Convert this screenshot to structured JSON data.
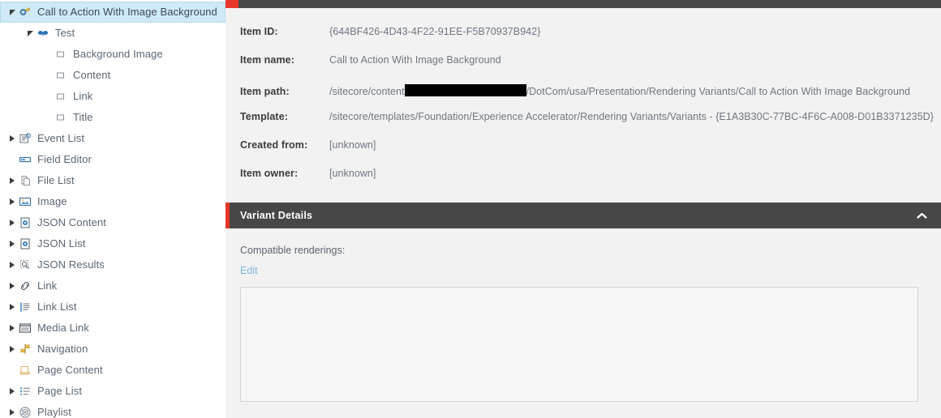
{
  "sidebar": {
    "items": [
      {
        "label": "Call to Action With Image Background",
        "icon": "variant-icon",
        "depth": 0,
        "twisty": "expanded",
        "selected": true
      },
      {
        "label": "Test",
        "icon": "mask-icon",
        "depth": 1,
        "twisty": "expanded",
        "selected": false
      },
      {
        "label": "Background Image",
        "icon": "field-square-icon",
        "depth": 2,
        "twisty": "none",
        "selected": false
      },
      {
        "label": "Content",
        "icon": "field-square-icon",
        "depth": 2,
        "twisty": "none",
        "selected": false
      },
      {
        "label": "Link",
        "icon": "field-square-icon",
        "depth": 2,
        "twisty": "none",
        "selected": false
      },
      {
        "label": "Title",
        "icon": "field-square-icon",
        "depth": 2,
        "twisty": "none",
        "selected": false
      },
      {
        "label": "Event List",
        "icon": "event-list-icon",
        "depth": 0,
        "twisty": "collapsed",
        "selected": false
      },
      {
        "label": "Field Editor",
        "icon": "field-editor-icon",
        "depth": 0,
        "twisty": "none",
        "selected": false
      },
      {
        "label": "File List",
        "icon": "file-list-icon",
        "depth": 0,
        "twisty": "collapsed",
        "selected": false
      },
      {
        "label": "Image",
        "icon": "image-icon",
        "depth": 0,
        "twisty": "collapsed",
        "selected": false
      },
      {
        "label": "JSON Content",
        "icon": "json-content-icon",
        "depth": 0,
        "twisty": "collapsed",
        "selected": false
      },
      {
        "label": "JSON List",
        "icon": "json-list-icon",
        "depth": 0,
        "twisty": "collapsed",
        "selected": false
      },
      {
        "label": "JSON Results",
        "icon": "json-results-icon",
        "depth": 0,
        "twisty": "collapsed",
        "selected": false
      },
      {
        "label": "Link",
        "icon": "link-icon",
        "depth": 0,
        "twisty": "collapsed",
        "selected": false
      },
      {
        "label": "Link List",
        "icon": "link-list-icon",
        "depth": 0,
        "twisty": "collapsed",
        "selected": false
      },
      {
        "label": "Media Link",
        "icon": "media-link-icon",
        "depth": 0,
        "twisty": "collapsed",
        "selected": false
      },
      {
        "label": "Navigation",
        "icon": "navigation-icon",
        "depth": 0,
        "twisty": "collapsed",
        "selected": false
      },
      {
        "label": "Page Content",
        "icon": "page-content-icon",
        "depth": 0,
        "twisty": "none",
        "selected": false
      },
      {
        "label": "Page List",
        "icon": "page-list-icon",
        "depth": 0,
        "twisty": "collapsed",
        "selected": false
      },
      {
        "label": "Playlist",
        "icon": "playlist-icon",
        "depth": 0,
        "twisty": "collapsed",
        "selected": false
      }
    ]
  },
  "item_details": {
    "fields": [
      {
        "label": "Item ID:",
        "value": "{644BF426-4D43-4F22-91EE-F5B70937B942}",
        "redacted": false
      },
      {
        "label": "Item name:",
        "value": "Call to Action With Image Background",
        "redacted": false
      },
      {
        "label": "Item path:",
        "value_before": "/sitecore/content",
        "value_after": "/DotCom/usa/Presentation/Rendering Variants/Call to Action With Image Background",
        "redacted": true
      },
      {
        "label": "Template:",
        "value": "/sitecore/templates/Foundation/Experience Accelerator/Rendering Variants/Variants - {E1A3B30C-77BC-4F6C-A008-D01B3371235D}",
        "redacted": false
      },
      {
        "label": "Created from:",
        "value": "[unknown]",
        "redacted": false
      },
      {
        "label": "Item owner:",
        "value": "[unknown]",
        "redacted": false
      }
    ]
  },
  "variant_details": {
    "title": "Variant Details",
    "collapse_icon": "chevron-up-icon",
    "compatible_renderings_label": "Compatible renderings:",
    "edit_link": "Edit"
  },
  "colors": {
    "accent_red": "#e8352a",
    "header_dark": "#474747",
    "selection_blue": "#cfe9f7",
    "link_blue": "#7fb4d8",
    "page_bg": "#f2f2f2"
  }
}
